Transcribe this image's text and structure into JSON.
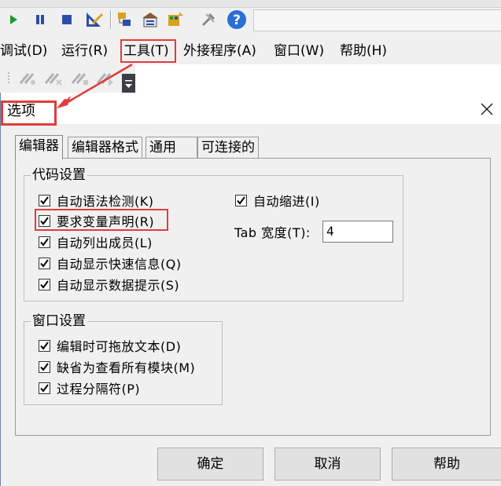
{
  "menubar": {
    "items": [
      {
        "label": "调试(D)"
      },
      {
        "label": "运行(R)"
      },
      {
        "label": "工具(T)"
      },
      {
        "label": "外接程序(A)"
      },
      {
        "label": "窗口(W)"
      },
      {
        "label": "帮助(H)"
      }
    ]
  },
  "toolbar": {
    "icons": [
      "run-icon",
      "pause-icon",
      "stop-icon",
      "design-mode-icon",
      "project-explorer-icon",
      "properties-icon",
      "object-browser-icon",
      "toolbox-icon",
      "help-icon"
    ]
  },
  "dialog": {
    "title": "选项",
    "tabs": [
      {
        "label": "编辑器",
        "active": true
      },
      {
        "label": "编辑器格式",
        "active": false
      },
      {
        "label": "通用",
        "active": false
      },
      {
        "label": "可连接的",
        "active": false
      }
    ],
    "code_settings": {
      "title": "代码设置",
      "options": [
        {
          "label": "自动语法检测(K)",
          "checked": true
        },
        {
          "label": "要求变量声明(R)",
          "checked": true
        },
        {
          "label": "自动列出成员(L)",
          "checked": true
        },
        {
          "label": "自动显示快速信息(Q)",
          "checked": true
        },
        {
          "label": "自动显示数据提示(S)",
          "checked": true
        }
      ],
      "auto_indent": {
        "label": "自动缩进(I)",
        "checked": true
      },
      "tab_width": {
        "label": "Tab 宽度(T):",
        "value": "4"
      }
    },
    "window_settings": {
      "title": "窗口设置",
      "options": [
        {
          "label": "编辑时可拖放文本(D)",
          "checked": true
        },
        {
          "label": "缺省为查看所有模块(M)",
          "checked": true
        },
        {
          "label": "过程分隔符(P)",
          "checked": true
        }
      ]
    },
    "buttons": {
      "ok": "确定",
      "cancel": "取消",
      "help": "帮助"
    }
  },
  "colors": {
    "highlight": "#e23b3b",
    "dialog_bg": "#f0f0f0",
    "help_icon": "#2a6fd6"
  }
}
